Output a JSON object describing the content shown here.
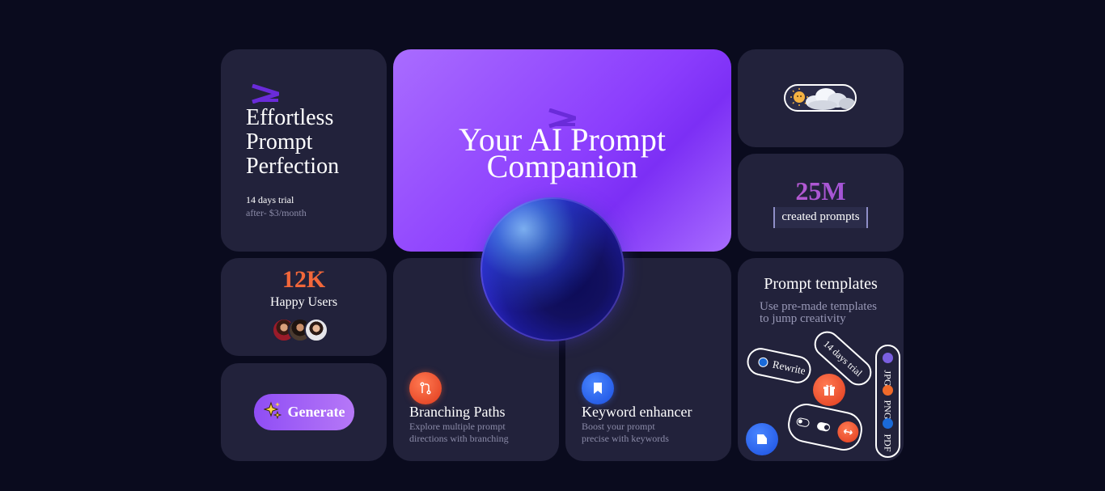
{
  "perfection_card": {
    "title_line1": "Effortless",
    "title_line2": "Prompt",
    "title_line3": "Perfection",
    "trial": "14 days trial",
    "price": "after- $3/month"
  },
  "hero_card": {
    "title_line1": "Your AI Prompt",
    "title_line2": "Companion"
  },
  "weather_card": {
    "icon": "sun-behind-cloud-icon"
  },
  "stats_prompts": {
    "value": "25M",
    "label": "created prompts"
  },
  "stats_users": {
    "value": "12K",
    "label": "Happy Users",
    "avatar_count": 3
  },
  "generate_card": {
    "button_label": "Generate",
    "icon": "sparkles-icon"
  },
  "branching_card": {
    "title": "Branching Paths",
    "desc_line1": "Explore multiple prompt",
    "desc_line2": "directions with branching",
    "icon": "branch-icon"
  },
  "keyword_card": {
    "title": "Keyword enhancer",
    "desc_line1": "Boost your prompt",
    "desc_line2": "precise with keywords",
    "icon": "bookmark-icon"
  },
  "templates_card": {
    "title": "Prompt templates",
    "desc_line1": "Use pre-made templates",
    "desc_line2": "to jump creativity",
    "chip_rewrite": "Rewrite",
    "chip_trial": "14 days trial",
    "formats": [
      "JPG",
      "PNG",
      "PDF"
    ]
  },
  "colors": {
    "background": "#0a0b1e",
    "card": "#22223b",
    "accent_purple": "#8b3dfd",
    "accent_orange": "#f2673a",
    "accent_blue": "#1a5cf0"
  }
}
